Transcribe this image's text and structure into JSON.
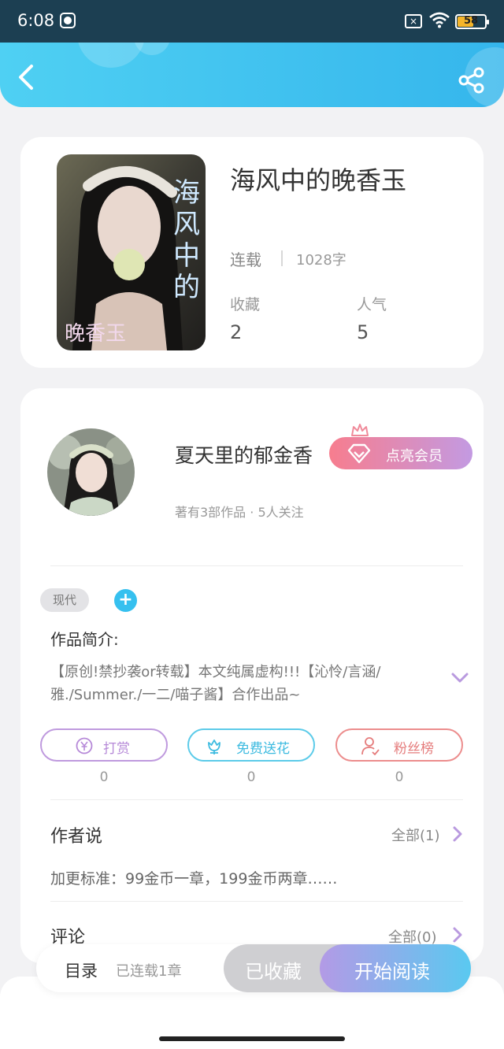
{
  "status_bar": {
    "time": "6:08",
    "battery": "58"
  },
  "book": {
    "title": "海风中的晚香玉",
    "status": "连载",
    "word_count": "1028字",
    "favorites_label": "收藏",
    "favorites_value": "2",
    "popularity_label": "人气",
    "popularity_value": "5"
  },
  "author": {
    "name": "夏天里的郁金香",
    "meta": "著有3部作品 · 5人关注",
    "vip_label": "点亮会员"
  },
  "tags": [
    "现代"
  ],
  "intro": {
    "label": "作品简介:",
    "text": "【原创!禁抄袭or转载】本文纯属虚构!!!【沁怜/言涵/雅./Summer./一二/喵子酱】合作出品~"
  },
  "actions": [
    {
      "label": "打赏",
      "count": "0",
      "icon": "yen-coin-icon"
    },
    {
      "label": "免费送花",
      "count": "0",
      "icon": "flower-icon"
    },
    {
      "label": "粉丝榜",
      "count": "0",
      "icon": "fans-user-icon"
    }
  ],
  "author_says": {
    "title": "作者说",
    "more": "全部(1)",
    "text": "加更标准：99金币一章，199金币两章……"
  },
  "comments": {
    "title": "评论",
    "more": "全部(0)"
  },
  "bottom": {
    "toc_label": "目录",
    "toc_sub": "已连载1章",
    "collected_label": "已收藏",
    "start_label": "开始阅读"
  },
  "colors": {
    "header_start": "#4fd0f3",
    "header_end": "#35b6ec",
    "accent_purple": "#b39ae6",
    "accent_blue": "#5ac9f0"
  }
}
